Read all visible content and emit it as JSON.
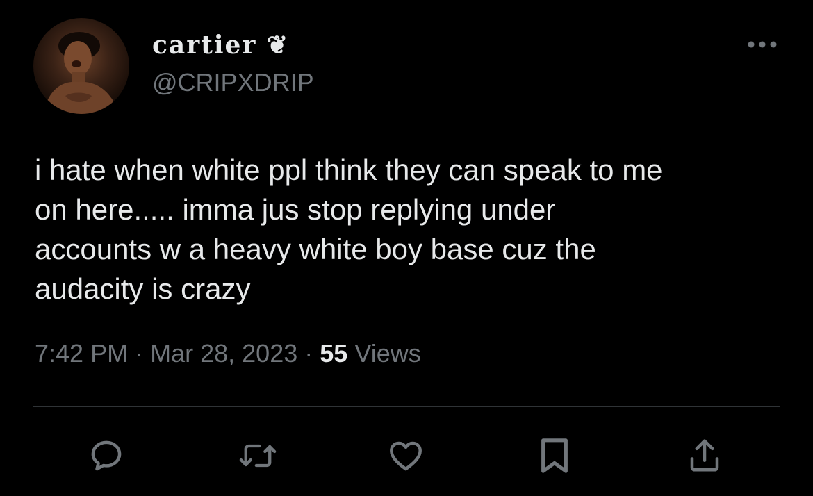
{
  "author": {
    "display_name": "cartier ❦",
    "handle": "@CRIPXDRIP",
    "avatar_icon": "profile-photo"
  },
  "tweet": {
    "text": "i hate when white ppl think they can speak to me\non here..... imma jus stop replying under\naccounts w a heavy white boy base cuz the\naudacity is crazy",
    "time": "7:42 PM",
    "separator": "·",
    "date": "Mar 28, 2023",
    "views_count": "55",
    "views_label": "Views"
  },
  "actions": [
    {
      "icon": "reply-icon"
    },
    {
      "icon": "retweet-icon"
    },
    {
      "icon": "like-icon"
    },
    {
      "icon": "bookmark-icon"
    },
    {
      "icon": "share-icon"
    }
  ],
  "colors": {
    "background": "#000000",
    "primary_text": "#e7e9ea",
    "secondary_text": "#71767b",
    "divider": "#2f3336"
  }
}
